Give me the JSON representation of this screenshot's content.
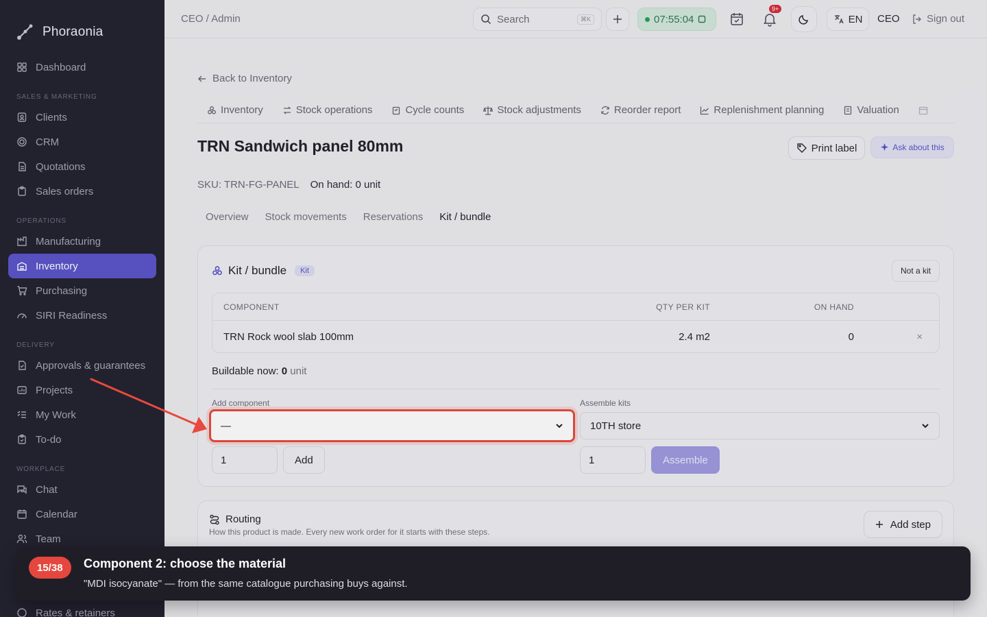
{
  "app": {
    "name": "Phoraonia"
  },
  "sidebar": {
    "items_top": [
      {
        "label": "Dashboard",
        "icon": "grid-icon"
      }
    ],
    "sections": [
      {
        "label": "SALES & MARKETING",
        "items": [
          {
            "label": "Clients",
            "icon": "contact-icon"
          },
          {
            "label": "CRM",
            "icon": "target-icon"
          },
          {
            "label": "Quotations",
            "icon": "document-icon"
          },
          {
            "label": "Sales orders",
            "icon": "clipboard-icon"
          }
        ]
      },
      {
        "label": "OPERATIONS",
        "items": [
          {
            "label": "Manufacturing",
            "icon": "factory-icon"
          },
          {
            "label": "Inventory",
            "icon": "warehouse-icon",
            "active": true
          },
          {
            "label": "Purchasing",
            "icon": "cart-icon"
          },
          {
            "label": "SIRI Readiness",
            "icon": "gauge-icon"
          }
        ]
      },
      {
        "label": "DELIVERY",
        "items": [
          {
            "label": "Approvals & guarantees",
            "icon": "document-check-icon"
          },
          {
            "label": "Projects",
            "icon": "chart-icon"
          },
          {
            "label": "My Work",
            "icon": "list-check-icon"
          },
          {
            "label": "To-do",
            "icon": "clipboard-check-icon"
          }
        ]
      },
      {
        "label": "WORKPLACE",
        "items": [
          {
            "label": "Chat",
            "icon": "chat-icon"
          },
          {
            "label": "Calendar",
            "icon": "calendar-icon"
          },
          {
            "label": "Team",
            "icon": "users-icon"
          }
        ]
      }
    ],
    "bottom_partial": "Rates & retainers"
  },
  "topbar": {
    "breadcrumb": "CEO / Admin",
    "search_label": "Search",
    "search_kbd": "⌘K",
    "timer": "07:55:04",
    "notif_count": "9+",
    "lang": "EN",
    "role": "CEO",
    "signout": "Sign out"
  },
  "page": {
    "back_link": "Back to Inventory",
    "subnav": [
      "Inventory",
      "Stock operations",
      "Cycle counts",
      "Stock adjustments",
      "Reorder report",
      "Replenishment planning",
      "Valuation"
    ],
    "title": "TRN Sandwich panel 80mm",
    "print_label": "Print label",
    "ask_label": "Ask about this",
    "sku": "SKU: TRN-FG-PANEL",
    "on_hand": "On hand: 0 unit",
    "tabs": [
      "Overview",
      "Stock movements",
      "Reservations",
      "Kit / bundle"
    ],
    "active_tab": "Kit / bundle"
  },
  "kit": {
    "title": "Kit / bundle",
    "badge": "Kit",
    "not_kit_label": "Not a kit",
    "columns": [
      "COMPONENT",
      "QTY PER KIT",
      "ON HAND"
    ],
    "rows": [
      {
        "component": "TRN Rock wool slab 100mm",
        "qty": "2.4 m2",
        "on_hand": "0"
      }
    ],
    "remove_glyph": "×",
    "buildable_label": "Buildable now:",
    "buildable_value": "0",
    "buildable_unit": "unit",
    "add_component_label": "Add component",
    "add_component_value": "—",
    "add_qty": "1",
    "add_button": "Add",
    "assemble_label": "Assemble kits",
    "assemble_location": "10TH store",
    "assemble_qty": "1",
    "assemble_button": "Assemble"
  },
  "routing": {
    "title": "Routing",
    "subtitle": "How this product is made. Every new work order for it starts with these steps.",
    "add_step": "Add step"
  },
  "tour": {
    "step": "15/38",
    "title": "Component 2: choose the material",
    "body": "\"MDI isocyanate\" — from the same catalogue purchasing buys against."
  },
  "colors": {
    "accent": "#5b55c9",
    "highlight": "#e84a3d",
    "sidebar_bg": "#24222f"
  }
}
